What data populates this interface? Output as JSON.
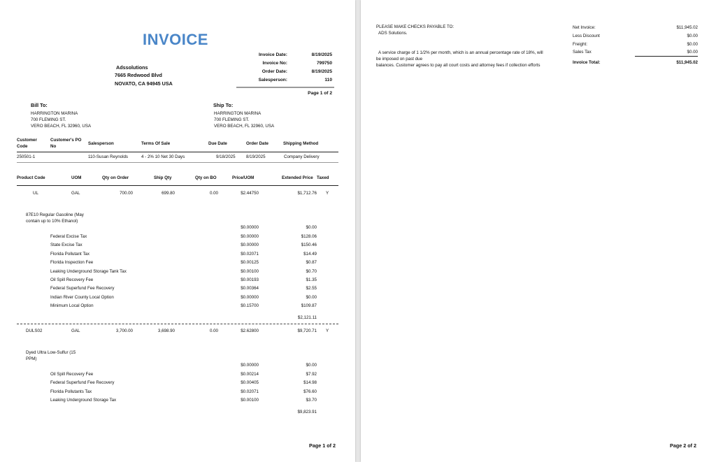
{
  "page1": {
    "title": "INVOICE",
    "company": {
      "name": "Adssolutions",
      "address1": "7665 Redwood Blvd",
      "address2": "NOVATO, CA 94945 USA"
    },
    "meta": [
      {
        "label": "Invoice Date:",
        "value": "8/19/2025"
      },
      {
        "label": "Invoice No:",
        "value": "799750"
      },
      {
        "label": "Order Date:",
        "value": "8/19/2025"
      },
      {
        "label": "Salesperson:",
        "value": "110"
      }
    ],
    "page_label_top": "Page 1 of 2",
    "bill_to": {
      "heading": "Bill To:",
      "lines": [
        "HARRINGTON MARINA",
        "700 FLEMING ST.",
        "VERO BEACH, FL 32960, USA"
      ]
    },
    "ship_to": {
      "heading": "Ship To:",
      "lines": [
        "HARRINGTON MARINA",
        "700 FLEMING ST.",
        "VERO BEACH, FL 32960, USA"
      ]
    },
    "order_headers": {
      "customer_code": [
        "Customer",
        "Code"
      ],
      "customer_po": [
        "Customer's PO",
        "No"
      ],
      "salesperson": "Salesperson",
      "terms": "Terms Of Sale",
      "due_date": "Due Date",
      "order_date": "Order Date",
      "shipping": "Shipping Method"
    },
    "order_row": {
      "customer_code": "250501-1",
      "customer_po": "",
      "salesperson": "110-Susan Reynolds",
      "terms": "4 - 2% 10 Net 30 Days",
      "due_date": "9/18/2025",
      "order_date": "8/19/2025",
      "shipping": "Company Delivery"
    },
    "line_headers": {
      "product_code": "Product Code",
      "uom": "UOM",
      "qty_on_order": "Qty on Order",
      "ship_qty": "Ship Qty",
      "qty_on_bo": "Qty on BO",
      "price_uom": "Price/UOM",
      "extended_price": "Extended Price",
      "taxed": "Taxed"
    },
    "items": [
      {
        "product_code": "UL",
        "uom": "GAL",
        "qty_on_order": "700.00",
        "ship_qty": "699.80",
        "qty_on_bo": "0.00",
        "price": "$2.44750",
        "extended": "$1,712.76",
        "taxed": "Y",
        "description": [
          "87E10 Regular Gasoline (May",
          "contain up to 10% Ethanol)"
        ],
        "detail_price": "$0.00000",
        "detail_ext": "$0.00",
        "taxes": [
          {
            "name": "Federal Excise Tax",
            "rate": "$0.00000",
            "amount": "$128.06"
          },
          {
            "name": "State Excise Tax",
            "rate": "$0.00000",
            "amount": "$150.46"
          },
          {
            "name": "Florida Pollutant Tax",
            "rate": "$0.02071",
            "amount": "$14.49"
          },
          {
            "name": "Florida Inspection Fee",
            "rate": "$0.00125",
            "amount": "$0.87"
          },
          {
            "name": "Leaking Underground Storage Tank Tax",
            "rate": "$0.00100",
            "amount": "$0.70"
          },
          {
            "name": "Oil Spill Recovery Fee",
            "rate": "$0.00193",
            "amount": "$1.35"
          },
          {
            "name": "Federal Superfund Fee Recovery",
            "rate": "$0.00364",
            "amount": "$2.55"
          },
          {
            "name": "Indian River County Local Option",
            "rate": "$0.00000",
            "amount": "$0.00"
          },
          {
            "name": "Minimum Local Option",
            "rate": "$0.15700",
            "amount": "$109.87"
          }
        ],
        "subtotal": "$2,121.11"
      },
      {
        "product_code": "DULS02",
        "uom": "GAL",
        "qty_on_order": "3,700.00",
        "ship_qty": "3,698.90",
        "qty_on_bo": "0.00",
        "price": "$2.62800",
        "extended": "$9,720.71",
        "taxed": "Y",
        "description": [
          "Dyed Ultra Low-Sulfur (15",
          "PPM)"
        ],
        "detail_price": "$0.00000",
        "detail_ext": "$0.00",
        "taxes": [
          {
            "name": "Oil Spill Recovery Fee",
            "rate": "$0.00214",
            "amount": "$7.92"
          },
          {
            "name": "Federal Superfund Fee Recovery",
            "rate": "$0.00405",
            "amount": "$14.98"
          },
          {
            "name": "Florida Pollutants Tax",
            "rate": "$0.02071",
            "amount": "$76.60"
          },
          {
            "name": "Leaking Underground Storage Tax",
            "rate": "$0.00100",
            "amount": "$3.70"
          }
        ],
        "subtotal": "$9,823.91"
      }
    ],
    "footer": "Page 1 of 2"
  },
  "page2": {
    "payable_heading": "PLEASE MAKE CHECKS PAYABLE TO:",
    "payable_to": "ADS Solutions.",
    "terms_text": [
      "A service charge of 1 1/2% per month, which is an annual percentage rate of 18%, will",
      "be imposed on past due",
      "balances. Customer agrees to pay all court costs and attorney fees if collection efforts"
    ],
    "totals": [
      {
        "label": "Net Invoice:",
        "value": "$11,945.02"
      },
      {
        "label": "Less Discount",
        "value": "$0.00"
      },
      {
        "label": "Freight:",
        "value": "$0.00"
      },
      {
        "label": "Sales Tax",
        "value": "$0.00"
      }
    ],
    "invoice_total_label": "Invoice Total:",
    "invoice_total_value": "$11,945.02",
    "footer": "Page 2 of 2"
  }
}
